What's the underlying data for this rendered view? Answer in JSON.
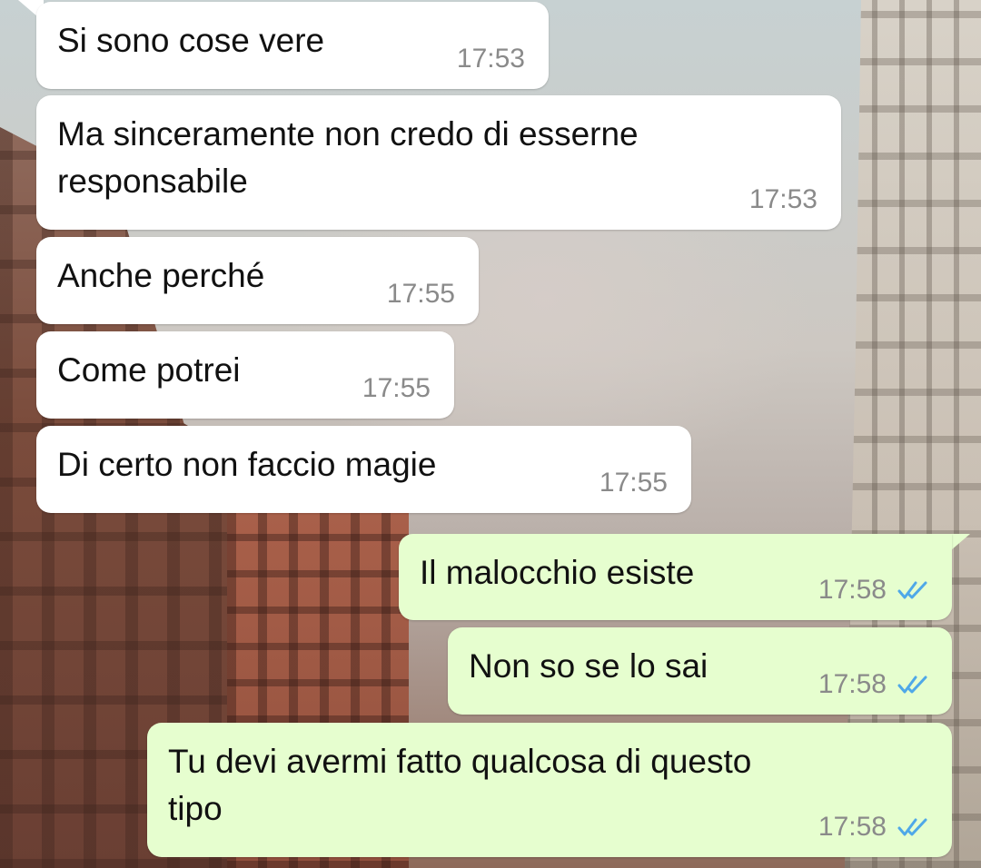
{
  "messages": [
    {
      "direction": "in",
      "text": "Si sono cose vere",
      "time": "17:53"
    },
    {
      "direction": "in",
      "text": "Ma sinceramente non credo di esserne\nresponsabile",
      "time": "17:53"
    },
    {
      "direction": "in",
      "text": "Anche perché",
      "time": "17:55"
    },
    {
      "direction": "in",
      "text": "Come potrei",
      "time": "17:55"
    },
    {
      "direction": "in",
      "text": "Di certo non faccio magie",
      "time": "17:55"
    },
    {
      "direction": "out",
      "text": "Il malocchio esiste",
      "time": "17:58",
      "status_icon": "double-check-icon",
      "status": "read"
    },
    {
      "direction": "out",
      "text": "Non so se lo sai",
      "time": "17:58",
      "status_icon": "double-check-icon",
      "status": "read"
    },
    {
      "direction": "out",
      "text": "Tu devi avermi fatto qualcosa di questo\ntipo",
      "time": "17:58",
      "status_icon": "double-check-icon",
      "status": "read"
    }
  ],
  "colors": {
    "incoming_bubble": "#ffffff",
    "outgoing_bubble": "#e6fecf",
    "read_ticks": "#4fa8e8",
    "timestamp": "#8a8a8a",
    "text": "#111111"
  }
}
